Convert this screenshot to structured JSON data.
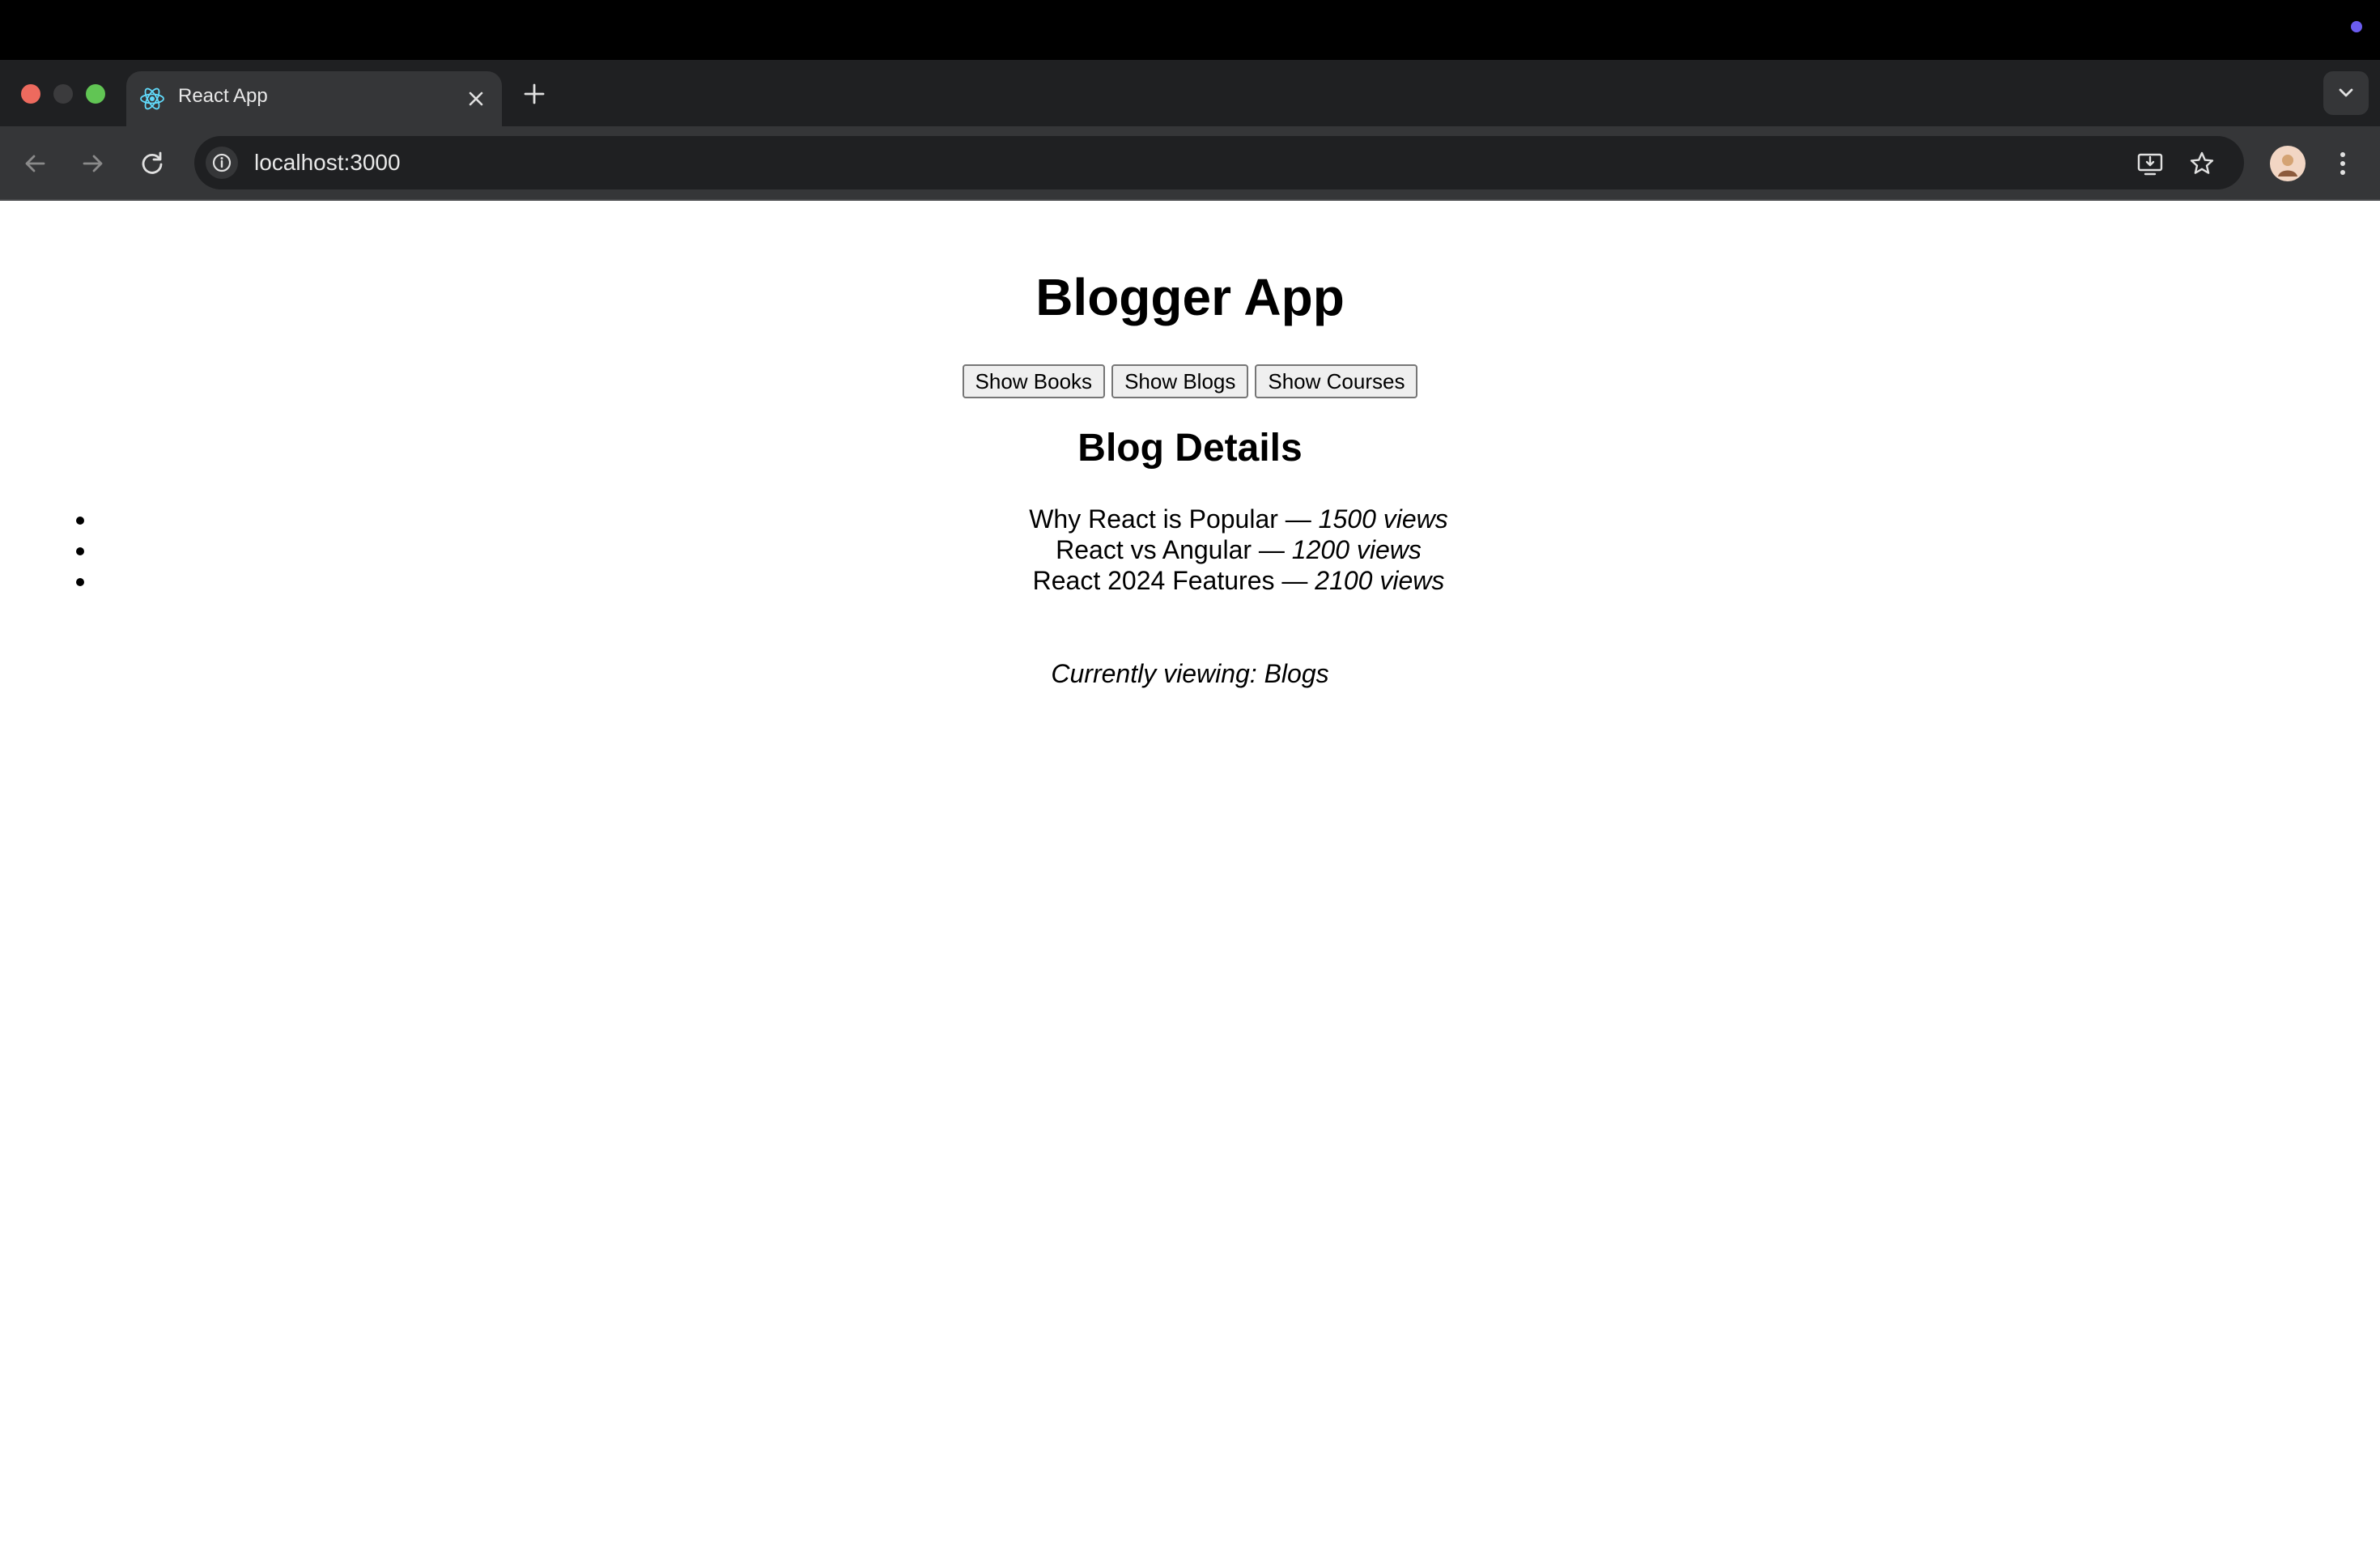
{
  "browser": {
    "tab_title": "React App",
    "url": "localhost:3000"
  },
  "app": {
    "title": "Blogger App",
    "buttons": [
      "Show Books",
      "Show Blogs",
      "Show Courses"
    ],
    "section_title": "Blog Details",
    "blogs": [
      {
        "title": "Why React is Popular",
        "separator": "—",
        "views": "1500 views"
      },
      {
        "title": "React vs Angular",
        "separator": "—",
        "views": "1200 views"
      },
      {
        "title": "React 2024 Features",
        "separator": "—",
        "views": "2100 views"
      }
    ],
    "status": "Currently viewing: Blogs"
  },
  "icons": {
    "favicon": "react-logo-icon",
    "tab_close": "close-icon",
    "new_tab": "plus-icon",
    "tab_dropdown": "chevron-down-icon",
    "back": "arrow-left-icon",
    "forward": "arrow-right-icon",
    "reload": "reload-icon",
    "site_info": "info-icon",
    "install": "install-app-icon",
    "bookmark": "star-icon",
    "menu": "kebab-menu-icon"
  },
  "colors": {
    "traffic_red": "#ed6a5e",
    "traffic_green": "#61c554",
    "os_indicator": "#6b5cf0"
  }
}
